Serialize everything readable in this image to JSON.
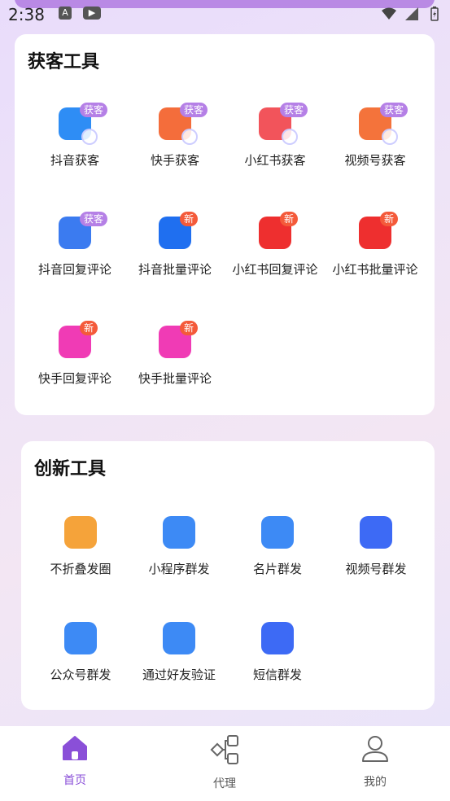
{
  "status": {
    "time": "2:38"
  },
  "section1": {
    "title": "获客工具",
    "tools": [
      {
        "label": "抖音获客",
        "badge": "获客",
        "badge_type": "purple",
        "icon": "douyin-icon",
        "color": "#2e8df5"
      },
      {
        "label": "快手获客",
        "badge": "获客",
        "badge_type": "purple",
        "icon": "kuaishou-icon",
        "color": "#f46d3b"
      },
      {
        "label": "小红书获客",
        "badge": "获客",
        "badge_type": "purple",
        "icon": "xiaohongshu-icon",
        "color": "#f2545b"
      },
      {
        "label": "视频号获客",
        "badge": "获客",
        "badge_type": "purple",
        "icon": "shipinhao-icon",
        "color": "#f4733b"
      },
      {
        "label": "抖音回复评论",
        "badge": "获客",
        "badge_type": "purple",
        "icon": "douyin-reply-icon",
        "color": "#3b7bf0"
      },
      {
        "label": "抖音批量评论",
        "badge": "新",
        "badge_type": "red",
        "icon": "douyin-batch-icon",
        "color": "#1f6ff0"
      },
      {
        "label": "小红书回复评论",
        "badge": "新",
        "badge_type": "red",
        "icon": "xhs-reply-icon",
        "color": "#ee2f2f"
      },
      {
        "label": "小红书批量评论",
        "badge": "新",
        "badge_type": "red",
        "icon": "xhs-batch-icon",
        "color": "#ee2f2f"
      },
      {
        "label": "快手回复评论",
        "badge": "新",
        "badge_type": "red",
        "icon": "kuaishou-reply-icon",
        "color": "#f03bb5"
      },
      {
        "label": "快手批量评论",
        "badge": "新",
        "badge_type": "red",
        "icon": "kuaishou-batch-icon",
        "color": "#f03bb5"
      }
    ]
  },
  "section2": {
    "title": "创新工具",
    "tools": [
      {
        "label": "不折叠发圈",
        "icon": "moments-icon",
        "color": "#f5a33a"
      },
      {
        "label": "小程序群发",
        "icon": "paper-plane-icon",
        "color": "#3d8af5"
      },
      {
        "label": "名片群发",
        "icon": "card-share-icon",
        "color": "#3d8af5"
      },
      {
        "label": "视频号群发",
        "icon": "tv-icon",
        "color": "#3d6af5"
      },
      {
        "label": "公众号群发",
        "icon": "official-account-icon",
        "color": "#3d8af5"
      },
      {
        "label": "通过好友验证",
        "icon": "friend-verify-icon",
        "color": "#3d8af5"
      },
      {
        "label": "短信群发",
        "icon": "sms-icon",
        "color": "#3d6af5"
      }
    ]
  },
  "nav": {
    "items": [
      {
        "label": "首页",
        "icon": "home-icon",
        "active": true
      },
      {
        "label": "代理",
        "icon": "agent-icon",
        "active": false
      },
      {
        "label": "我的",
        "icon": "profile-icon",
        "active": false
      }
    ],
    "active_color": "#8a4fd8"
  }
}
